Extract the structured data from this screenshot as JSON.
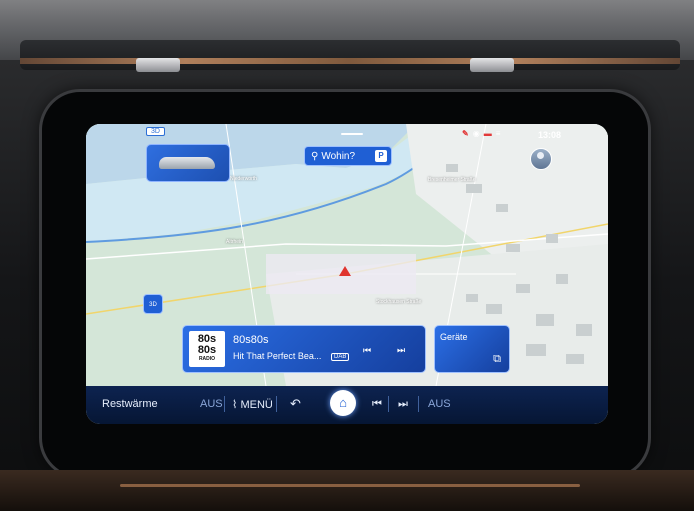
{
  "status": {
    "mode_tag": "3D",
    "time": "13:08"
  },
  "search": {
    "label": "Wohin?",
    "icon": "search-icon",
    "poi_label": "P"
  },
  "map": {
    "labels": {
      "l1": "Niederworth",
      "l2": "Altrhein",
      "l3": "Bresenheimer Straße",
      "l4": "Stockhausen Straße"
    },
    "view_button": "3D"
  },
  "media": {
    "logo_line1": "80s",
    "logo_line2": "80s",
    "logo_line3": "RADIO",
    "station": "80s80s",
    "track": "Hit That Perfect Bea...",
    "source_badge": "DAB",
    "prev_icon": "prev-icon",
    "next_icon": "next-icon"
  },
  "devices": {
    "label": "Geräte",
    "icon": "device-switch-icon"
  },
  "bottombar": {
    "restwaerme": "Restwärme",
    "aus_left": "AUS",
    "menu": "MENÜ",
    "aus_right": "AUS"
  },
  "colors": {
    "accent": "#1f5fd4",
    "cursor": "#e0352f",
    "bar": "#0d2350"
  }
}
